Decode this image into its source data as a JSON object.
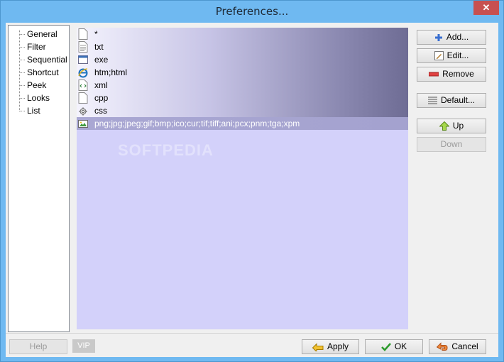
{
  "window": {
    "title": "Preferences...",
    "close_glyph": "✕"
  },
  "tree": {
    "items": [
      {
        "label": "General"
      },
      {
        "label": "Filter"
      },
      {
        "label": "Sequential"
      },
      {
        "label": "Shortcut"
      },
      {
        "label": "Peek"
      },
      {
        "label": "Looks"
      },
      {
        "label": "List"
      }
    ]
  },
  "filters": {
    "rows": [
      {
        "text": "*",
        "icon": "blank-file-icon"
      },
      {
        "text": "txt",
        "icon": "text-file-icon"
      },
      {
        "text": "exe",
        "icon": "exe-window-icon"
      },
      {
        "text": "htm;html",
        "icon": "ie-icon"
      },
      {
        "text": "xml",
        "icon": "xml-file-icon"
      },
      {
        "text": "cpp",
        "icon": "blank-file-icon"
      },
      {
        "text": "css",
        "icon": "css-gear-icon"
      },
      {
        "text": "png;jpg;jpeg;gif;bmp;ico;cur;tif;tiff;ani;pcx;pnm;tga;xpm",
        "icon": "image-file-icon",
        "selected": true
      }
    ]
  },
  "buttons": {
    "add": "Add...",
    "edit": "Edit...",
    "remove": "Remove",
    "default": "Default...",
    "up": "Up",
    "down": "Down",
    "help": "Help",
    "vip": "VIP",
    "apply": "Apply",
    "ok": "OK",
    "cancel": "Cancel"
  },
  "watermark": "SOFTPEDIA",
  "colors": {
    "titlebar": "#6fb9f1",
    "close": "#c75050",
    "list_bg": "#d3d1fa",
    "selected_row": "#a9a7d3"
  }
}
